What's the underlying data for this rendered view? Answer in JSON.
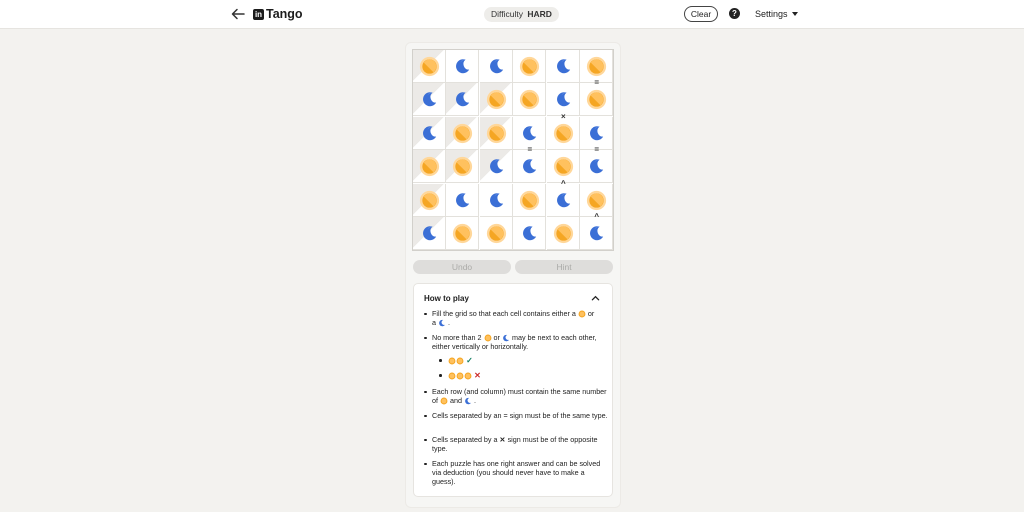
{
  "header": {
    "title": "Tango",
    "logo_text": "in",
    "difficulty_label": "Difficulty",
    "difficulty_value": "HARD",
    "clear_label": "Clear",
    "help_label": "?",
    "settings_label": "Settings"
  },
  "board": {
    "rows": [
      [
        "sun",
        "moon",
        "moon",
        "sun",
        "moon",
        "sun"
      ],
      [
        "moon",
        "moon",
        "sun",
        "sun",
        "moon",
        "sun"
      ],
      [
        "moon",
        "sun",
        "sun",
        "moon",
        "sun",
        "moon"
      ],
      [
        "sun",
        "sun",
        "moon",
        "moon",
        "sun",
        "moon"
      ],
      [
        "sun",
        "moon",
        "moon",
        "sun",
        "moon",
        "sun"
      ],
      [
        "moon",
        "sun",
        "sun",
        "moon",
        "sun",
        "moon"
      ]
    ],
    "locked": [
      [
        true,
        false,
        false,
        false,
        false,
        false
      ],
      [
        true,
        true,
        true,
        false,
        false,
        false
      ],
      [
        true,
        true,
        true,
        false,
        false,
        false
      ],
      [
        true,
        true,
        true,
        false,
        false,
        false
      ],
      [
        true,
        false,
        false,
        false,
        false,
        false
      ],
      [
        true,
        false,
        false,
        false,
        false,
        false
      ]
    ],
    "constraints": [
      {
        "row": 0,
        "col": 5,
        "dir": "down",
        "sign": "="
      },
      {
        "row": 1,
        "col": 4,
        "dir": "down",
        "sign": "×"
      },
      {
        "row": 2,
        "col": 3,
        "dir": "down",
        "sign": "="
      },
      {
        "row": 2,
        "col": 5,
        "dir": "down",
        "sign": "="
      },
      {
        "row": 3,
        "col": 4,
        "dir": "down",
        "sign": "^"
      },
      {
        "row": 4,
        "col": 5,
        "dir": "down",
        "sign": "^"
      }
    ]
  },
  "controls": {
    "undo_label": "Undo",
    "hint_label": "Hint"
  },
  "how_to_play": {
    "title": "How to play",
    "rule1_a": "Fill the grid so that each cell contains either a",
    "rule1_b": "or",
    "rule1_c": "a",
    "rule1_d": ".",
    "rule2_a": "No more than 2",
    "rule2_b": "or",
    "rule2_c": "may be next to each other, either vertically or horizontally.",
    "rule3_a": "Each row (and column) must contain the same number of",
    "rule3_b": "and",
    "rule3_c": ".",
    "rule4": "Cells separated by an = sign must be of the same type.",
    "rule5_a": "Cells separated by a",
    "rule5_b": "sign must be of the opposite type.",
    "rule6": "Each puzzle has one right answer and can be solved via deduction (you should never have to make a guess)."
  },
  "colors": {
    "sun": "#f5a623",
    "sun_light": "#ffd79a",
    "moon": "#3b6fd6",
    "accent": "#1d1d1d"
  }
}
